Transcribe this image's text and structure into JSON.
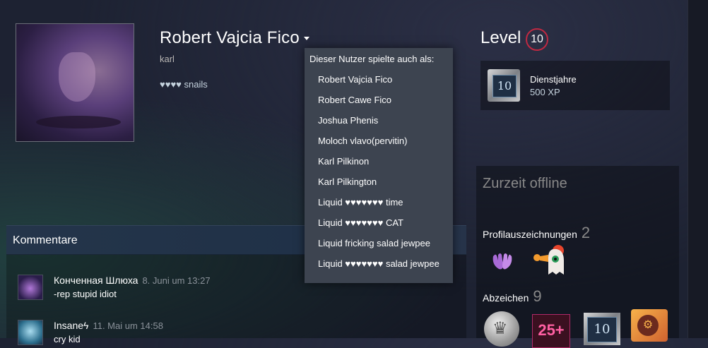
{
  "profile": {
    "name": "Robert Vajcia Fico",
    "real_name": "karl",
    "summary": "♥♥♥♥ snails"
  },
  "alias_dropdown": {
    "header": "Dieser Nutzer spielte auch als:",
    "items": [
      "Robert Vajcia Fico",
      "Robert Cawe Fico",
      "Joshua Phenis",
      "Moloch vlavo(pervitin)",
      "Karl Pilkinon",
      "Karl Pilkington",
      "Liquid ♥♥♥♥♥♥♥ time",
      "Liquid ♥♥♥♥♥♥♥ CAT",
      "Liquid fricking salad jewpee",
      "Liquid ♥♥♥♥♥♥♥ salad jewpee"
    ]
  },
  "level": {
    "label": "Level",
    "value": "10",
    "badge_color": "#c02942"
  },
  "years_badge": {
    "number": "10",
    "title": "Dienstjahre",
    "xp": "500 XP"
  },
  "status": {
    "text": "Zurzeit offline"
  },
  "awards": {
    "label": "Profilauszeichnungen",
    "count": "2"
  },
  "badges": {
    "label": "Abzeichen",
    "count": "9",
    "items": [
      {
        "icon": "coin-badge-icon"
      },
      {
        "text": "25+"
      },
      {
        "text": "10"
      },
      {
        "icon": "steam-badge-icon"
      }
    ]
  },
  "comments": {
    "title": "Kommentare",
    "list": [
      {
        "author": "Конченная Шлюха",
        "date": "8. Juni um 13:27",
        "text": "-rep stupid idiot"
      },
      {
        "author": "Insaneϟ",
        "date": "11. Mai um 14:58",
        "text": "cry kid"
      }
    ]
  }
}
